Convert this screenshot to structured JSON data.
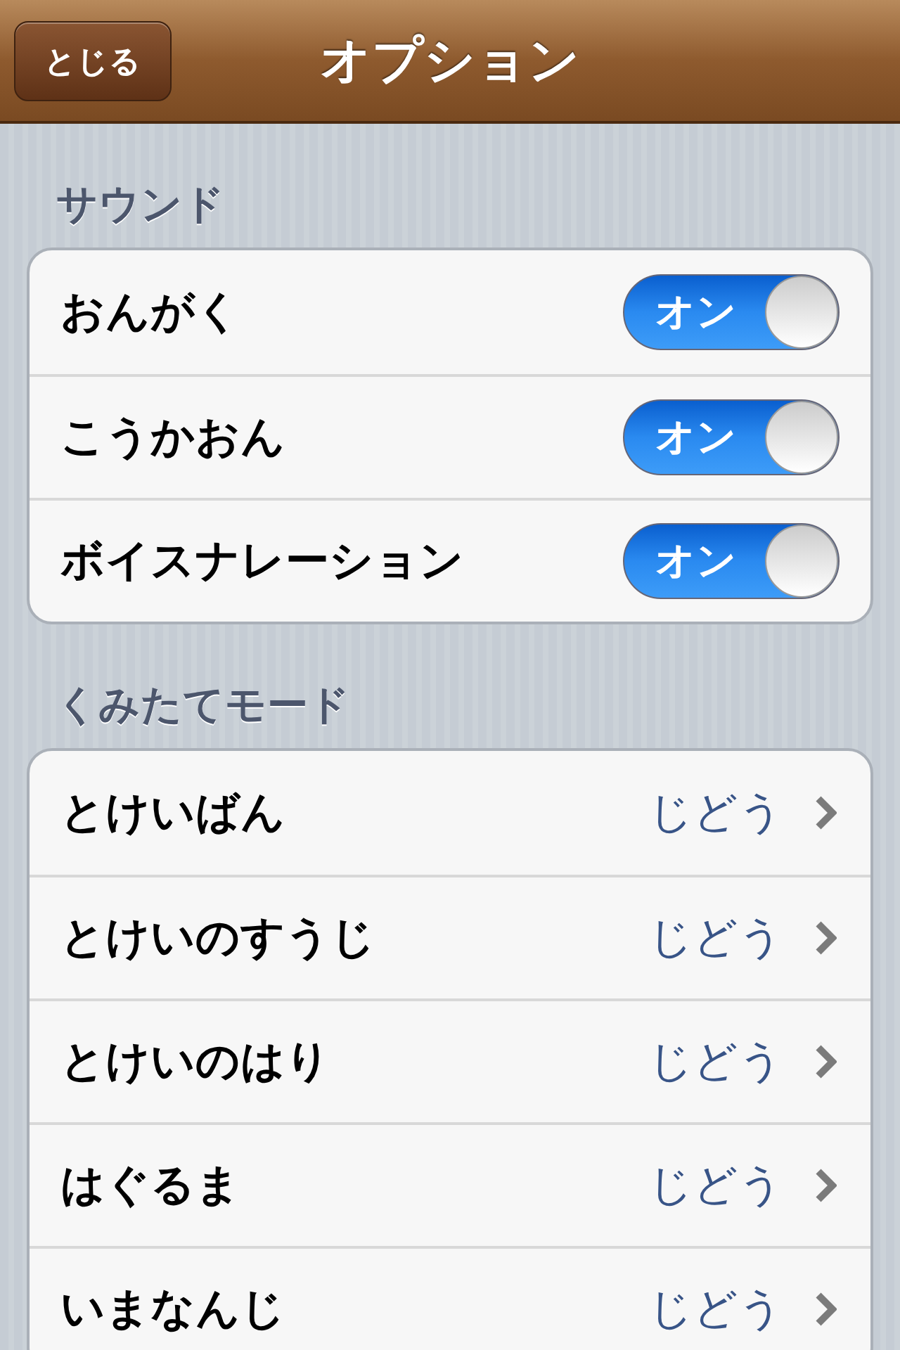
{
  "nav_bar": {
    "back_button": "とじる",
    "title": "オプション"
  },
  "sections": [
    {
      "header": "サウンド",
      "rows": [
        {
          "kind": "switch",
          "label": "おんがく",
          "on": true,
          "switch_label": "オン"
        },
        {
          "kind": "switch",
          "label": "こうかおん",
          "on": true,
          "switch_label": "オン"
        },
        {
          "kind": "switch",
          "label": "ボイスナレーション",
          "on": true,
          "switch_label": "オン"
        }
      ]
    },
    {
      "header": "くみたてモード",
      "rows": [
        {
          "kind": "detail",
          "label": "とけいばん",
          "value": "じどう"
        },
        {
          "kind": "detail",
          "label": "とけいのすうじ",
          "value": "じどう"
        },
        {
          "kind": "detail",
          "label": "とけいのはり",
          "value": "じどう"
        },
        {
          "kind": "detail",
          "label": "はぐるま",
          "value": "じどう"
        },
        {
          "kind": "detail",
          "label": "いまなんじ",
          "value": "じどう"
        }
      ]
    }
  ]
}
